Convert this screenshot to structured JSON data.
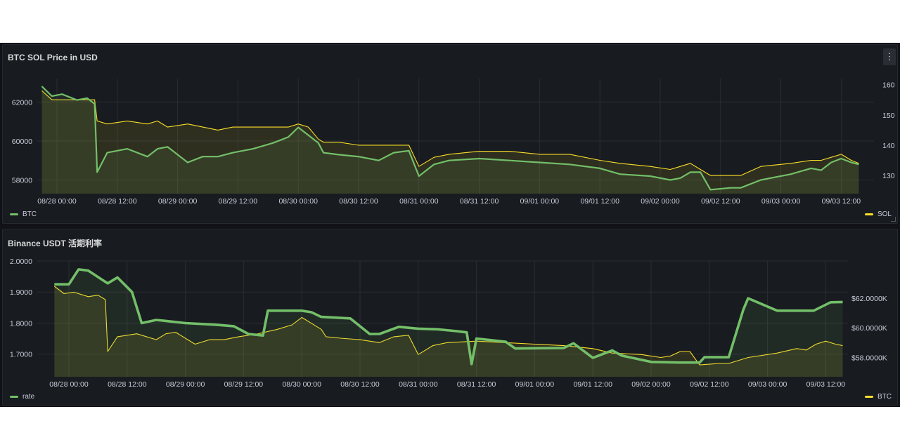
{
  "colors": {
    "btc": "#73bf69",
    "sol": "#fade2a",
    "grid": "#2a2d33",
    "background": "#181b1f",
    "text": "#ccccdc"
  },
  "panels": [
    {
      "title": "BTC SOL Price in USD",
      "menu_icon": "vertical-ellipsis-icon",
      "chart_data": {
        "type": "line",
        "x_ticks": [
          "08/28 00:00",
          "08/28 12:00",
          "08/29 00:00",
          "08/29 12:00",
          "08/30 00:00",
          "08/30 12:00",
          "08/31 00:00",
          "08/31 12:00",
          "09/01 00:00",
          "09/01 12:00",
          "09/02 00:00",
          "09/02 12:00",
          "09/03 00:00",
          "09/03 12:00"
        ],
        "y_left": {
          "ticks": [
            "62000",
            "60000",
            "58000"
          ],
          "range": [
            57300,
            63200
          ]
        },
        "y_right": {
          "ticks": [
            "160",
            "150",
            "140",
            "130"
          ],
          "range": [
            124,
            162
          ]
        },
        "series": [
          {
            "name": "BTC",
            "axis": "left",
            "color": "#73bf69",
            "x": [
              "08/27 21:00",
              "08/27 23:00",
              "08/28 01:00",
              "08/28 04:00",
              "08/28 06:00",
              "08/28 07:30",
              "08/28 08:00",
              "08/28 10:00",
              "08/28 14:00",
              "08/28 18:00",
              "08/28 20:00",
              "08/28 22:00",
              "08/29 02:00",
              "08/29 05:00",
              "08/29 08:00",
              "08/29 11:00",
              "08/29 15:00",
              "08/29 19:00",
              "08/29 22:00",
              "08/30 00:00",
              "08/30 02:00",
              "08/30 04:00",
              "08/30 05:00",
              "08/30 08:00",
              "08/30 12:00",
              "08/30 16:00",
              "08/30 19:00",
              "08/30 22:00",
              "08/31 00:00",
              "08/31 03:00",
              "08/31 06:00",
              "08/31 12:00",
              "08/31 18:00",
              "09/01 00:00",
              "09/01 06:00",
              "09/01 12:00",
              "09/01 16:00",
              "09/01 22:00",
              "09/02 02:00",
              "09/02 04:00",
              "09/02 06:00",
              "09/02 08:00",
              "09/02 10:00",
              "09/02 14:00",
              "09/02 16:00",
              "09/02 20:00",
              "09/03 02:00",
              "09/03 06:00",
              "09/03 08:00",
              "09/03 10:00",
              "09/03 12:00",
              "09/03 14:00",
              "09/03 15:30"
            ],
            "y": [
              62800,
              62300,
              62400,
              62100,
              62200,
              61900,
              58400,
              59400,
              59600,
              59200,
              59600,
              59700,
              58900,
              59200,
              59200,
              59400,
              59600,
              59900,
              60200,
              60700,
              60300,
              59900,
              59400,
              59300,
              59200,
              59000,
              59400,
              59500,
              58200,
              58800,
              59000,
              59100,
              59000,
              58900,
              58800,
              58600,
              58300,
              58200,
              58000,
              58100,
              58400,
              58400,
              57500,
              57600,
              57600,
              58000,
              58300,
              58600,
              58500,
              58900,
              59100,
              58900,
              58800
            ]
          },
          {
            "name": "SOL",
            "axis": "right",
            "color": "#fade2a",
            "x": [
              "08/27 21:00",
              "08/27 23:00",
              "08/28 01:00",
              "08/28 04:00",
              "08/28 06:00",
              "08/28 07:30",
              "08/28 08:00",
              "08/28 10:00",
              "08/28 14:00",
              "08/28 18:00",
              "08/28 20:00",
              "08/28 22:00",
              "08/29 02:00",
              "08/29 05:00",
              "08/29 08:00",
              "08/29 11:00",
              "08/29 15:00",
              "08/29 19:00",
              "08/29 22:00",
              "08/30 00:00",
              "08/30 02:00",
              "08/30 04:00",
              "08/30 05:00",
              "08/30 08:00",
              "08/30 12:00",
              "08/30 16:00",
              "08/30 19:00",
              "08/30 22:00",
              "08/31 00:00",
              "08/31 03:00",
              "08/31 06:00",
              "08/31 12:00",
              "08/31 18:00",
              "09/01 00:00",
              "09/01 06:00",
              "09/01 12:00",
              "09/01 16:00",
              "09/01 22:00",
              "09/02 02:00",
              "09/02 04:00",
              "09/02 06:00",
              "09/02 08:00",
              "09/02 10:00",
              "09/02 14:00",
              "09/02 16:00",
              "09/02 20:00",
              "09/03 02:00",
              "09/03 06:00",
              "09/03 08:00",
              "09/03 10:00",
              "09/03 12:00",
              "09/03 14:00",
              "09/03 15:30"
            ],
            "y": [
              158,
              155,
              155,
              155,
              155,
              155,
              148,
              147,
              148,
              147,
              148,
              146,
              147,
              146,
              145,
              146,
              146,
              146,
              146,
              147,
              146,
              142,
              141,
              141,
              140,
              140,
              140,
              140,
              133,
              136,
              137,
              138,
              138,
              137,
              137,
              135,
              134,
              133,
              132,
              133,
              134,
              132,
              130,
              130,
              130,
              133,
              134,
              135,
              135,
              136,
              137,
              135,
              134
            ]
          }
        ]
      },
      "legend_left": "BTC",
      "legend_right": "SOL"
    },
    {
      "title": "Binance USDT 活期利率",
      "chart_data": {
        "type": "line",
        "x_ticks": [
          "08/28 00:00",
          "08/28 12:00",
          "08/29 00:00",
          "08/29 12:00",
          "08/30 00:00",
          "08/30 12:00",
          "08/31 00:00",
          "08/31 12:00",
          "09/01 00:00",
          "09/01 12:00",
          "09/02 00:00",
          "09/02 12:00",
          "09/03 00:00",
          "09/03 12:00"
        ],
        "y_left": {
          "ticks": [
            "2.0000",
            "1.9000",
            "1.8000",
            "1.7000"
          ],
          "range": [
            1.627,
            2.0
          ]
        },
        "y_right": {
          "ticks": [
            "$62.0000K",
            "$60.0000K",
            "$58.0000K"
          ],
          "range": [
            56700,
            64500
          ]
        },
        "series": [
          {
            "name": "rate",
            "axis": "left",
            "color": "#73bf69",
            "x": [
              "08/27 21:00",
              "08/28 00:00",
              "08/28 02:00",
              "08/28 04:00",
              "08/28 07:00",
              "08/28 08:00",
              "08/28 10:00",
              "08/28 13:00",
              "08/28 15:00",
              "08/28 18:00",
              "08/28 20:00",
              "08/29 00:00",
              "08/29 06:00",
              "08/29 10:00",
              "08/29 13:00",
              "08/29 16:00",
              "08/29 17:00",
              "08/30 00:00",
              "08/30 02:00",
              "08/30 04:00",
              "08/30 10:00",
              "08/30 14:00",
              "08/30 16:00",
              "08/30 20:00",
              "08/31 00:00",
              "08/31 04:00",
              "08/31 08:00",
              "08/31 10:00",
              "08/31 11:00",
              "08/31 12:00",
              "08/31 18:00",
              "08/31 20:00",
              "09/01 06:00",
              "09/01 08:00",
              "09/01 12:00",
              "09/01 14:00",
              "09/01 16:00",
              "09/01 18:00",
              "09/02 00:00",
              "09/02 06:00",
              "09/02 10:00",
              "09/02 11:00",
              "09/02 16:00",
              "09/02 19:00",
              "09/02 20:00",
              "09/03 02:00",
              "09/03 08:00",
              "09/03 09:30",
              "09/03 13:00",
              "09/03 15:30"
            ],
            "y": [
              1.925,
              1.925,
              1.973,
              1.969,
              1.938,
              1.928,
              1.947,
              1.9,
              1.8,
              1.81,
              1.807,
              1.8,
              1.795,
              1.79,
              1.765,
              1.76,
              1.84,
              1.84,
              1.835,
              1.82,
              1.815,
              1.765,
              1.765,
              1.788,
              1.782,
              1.78,
              1.774,
              1.77,
              1.668,
              1.75,
              1.74,
              1.718,
              1.72,
              1.735,
              1.688,
              1.7,
              1.712,
              1.695,
              1.675,
              1.673,
              1.673,
              1.69,
              1.69,
              1.843,
              1.88,
              1.84,
              1.84,
              1.84,
              1.867,
              1.868
            ]
          },
          {
            "name": "BTC",
            "axis": "right",
            "color": "#fade2a",
            "x": [
              "08/27 21:00",
              "08/27 23:00",
              "08/28 01:00",
              "08/28 04:00",
              "08/28 06:00",
              "08/28 07:30",
              "08/28 08:00",
              "08/28 10:00",
              "08/28 14:00",
              "08/28 18:00",
              "08/28 20:00",
              "08/28 22:00",
              "08/29 02:00",
              "08/29 05:00",
              "08/29 08:00",
              "08/29 11:00",
              "08/29 15:00",
              "08/29 19:00",
              "08/29 22:00",
              "08/30 00:00",
              "08/30 02:00",
              "08/30 04:00",
              "08/30 05:00",
              "08/30 08:00",
              "08/30 12:00",
              "08/30 16:00",
              "08/30 19:00",
              "08/30 22:00",
              "08/31 00:00",
              "08/31 03:00",
              "08/31 06:00",
              "08/31 12:00",
              "08/31 18:00",
              "09/01 00:00",
              "09/01 06:00",
              "09/01 12:00",
              "09/01 16:00",
              "09/01 22:00",
              "09/02 02:00",
              "09/02 04:00",
              "09/02 06:00",
              "09/02 08:00",
              "09/02 10:00",
              "09/02 14:00",
              "09/02 16:00",
              "09/02 20:00",
              "09/03 02:00",
              "09/03 06:00",
              "09/03 08:00",
              "09/03 10:00",
              "09/03 12:00",
              "09/03 14:00",
              "09/03 15:30"
            ],
            "y": [
              62800,
              62300,
              62400,
              62100,
              62200,
              61900,
              58400,
              59400,
              59600,
              59200,
              59600,
              59700,
              58900,
              59200,
              59200,
              59400,
              59600,
              59900,
              60200,
              60700,
              60300,
              59900,
              59400,
              59300,
              59200,
              59000,
              59400,
              59500,
              58200,
              58800,
              59000,
              59100,
              59000,
              58900,
              58800,
              58600,
              58300,
              58200,
              58000,
              58100,
              58400,
              58400,
              57500,
              57600,
              57600,
              58000,
              58300,
              58600,
              58500,
              58900,
              59100,
              58900,
              58800
            ]
          }
        ]
      },
      "legend_left": "rate",
      "legend_right": "BTC"
    }
  ]
}
